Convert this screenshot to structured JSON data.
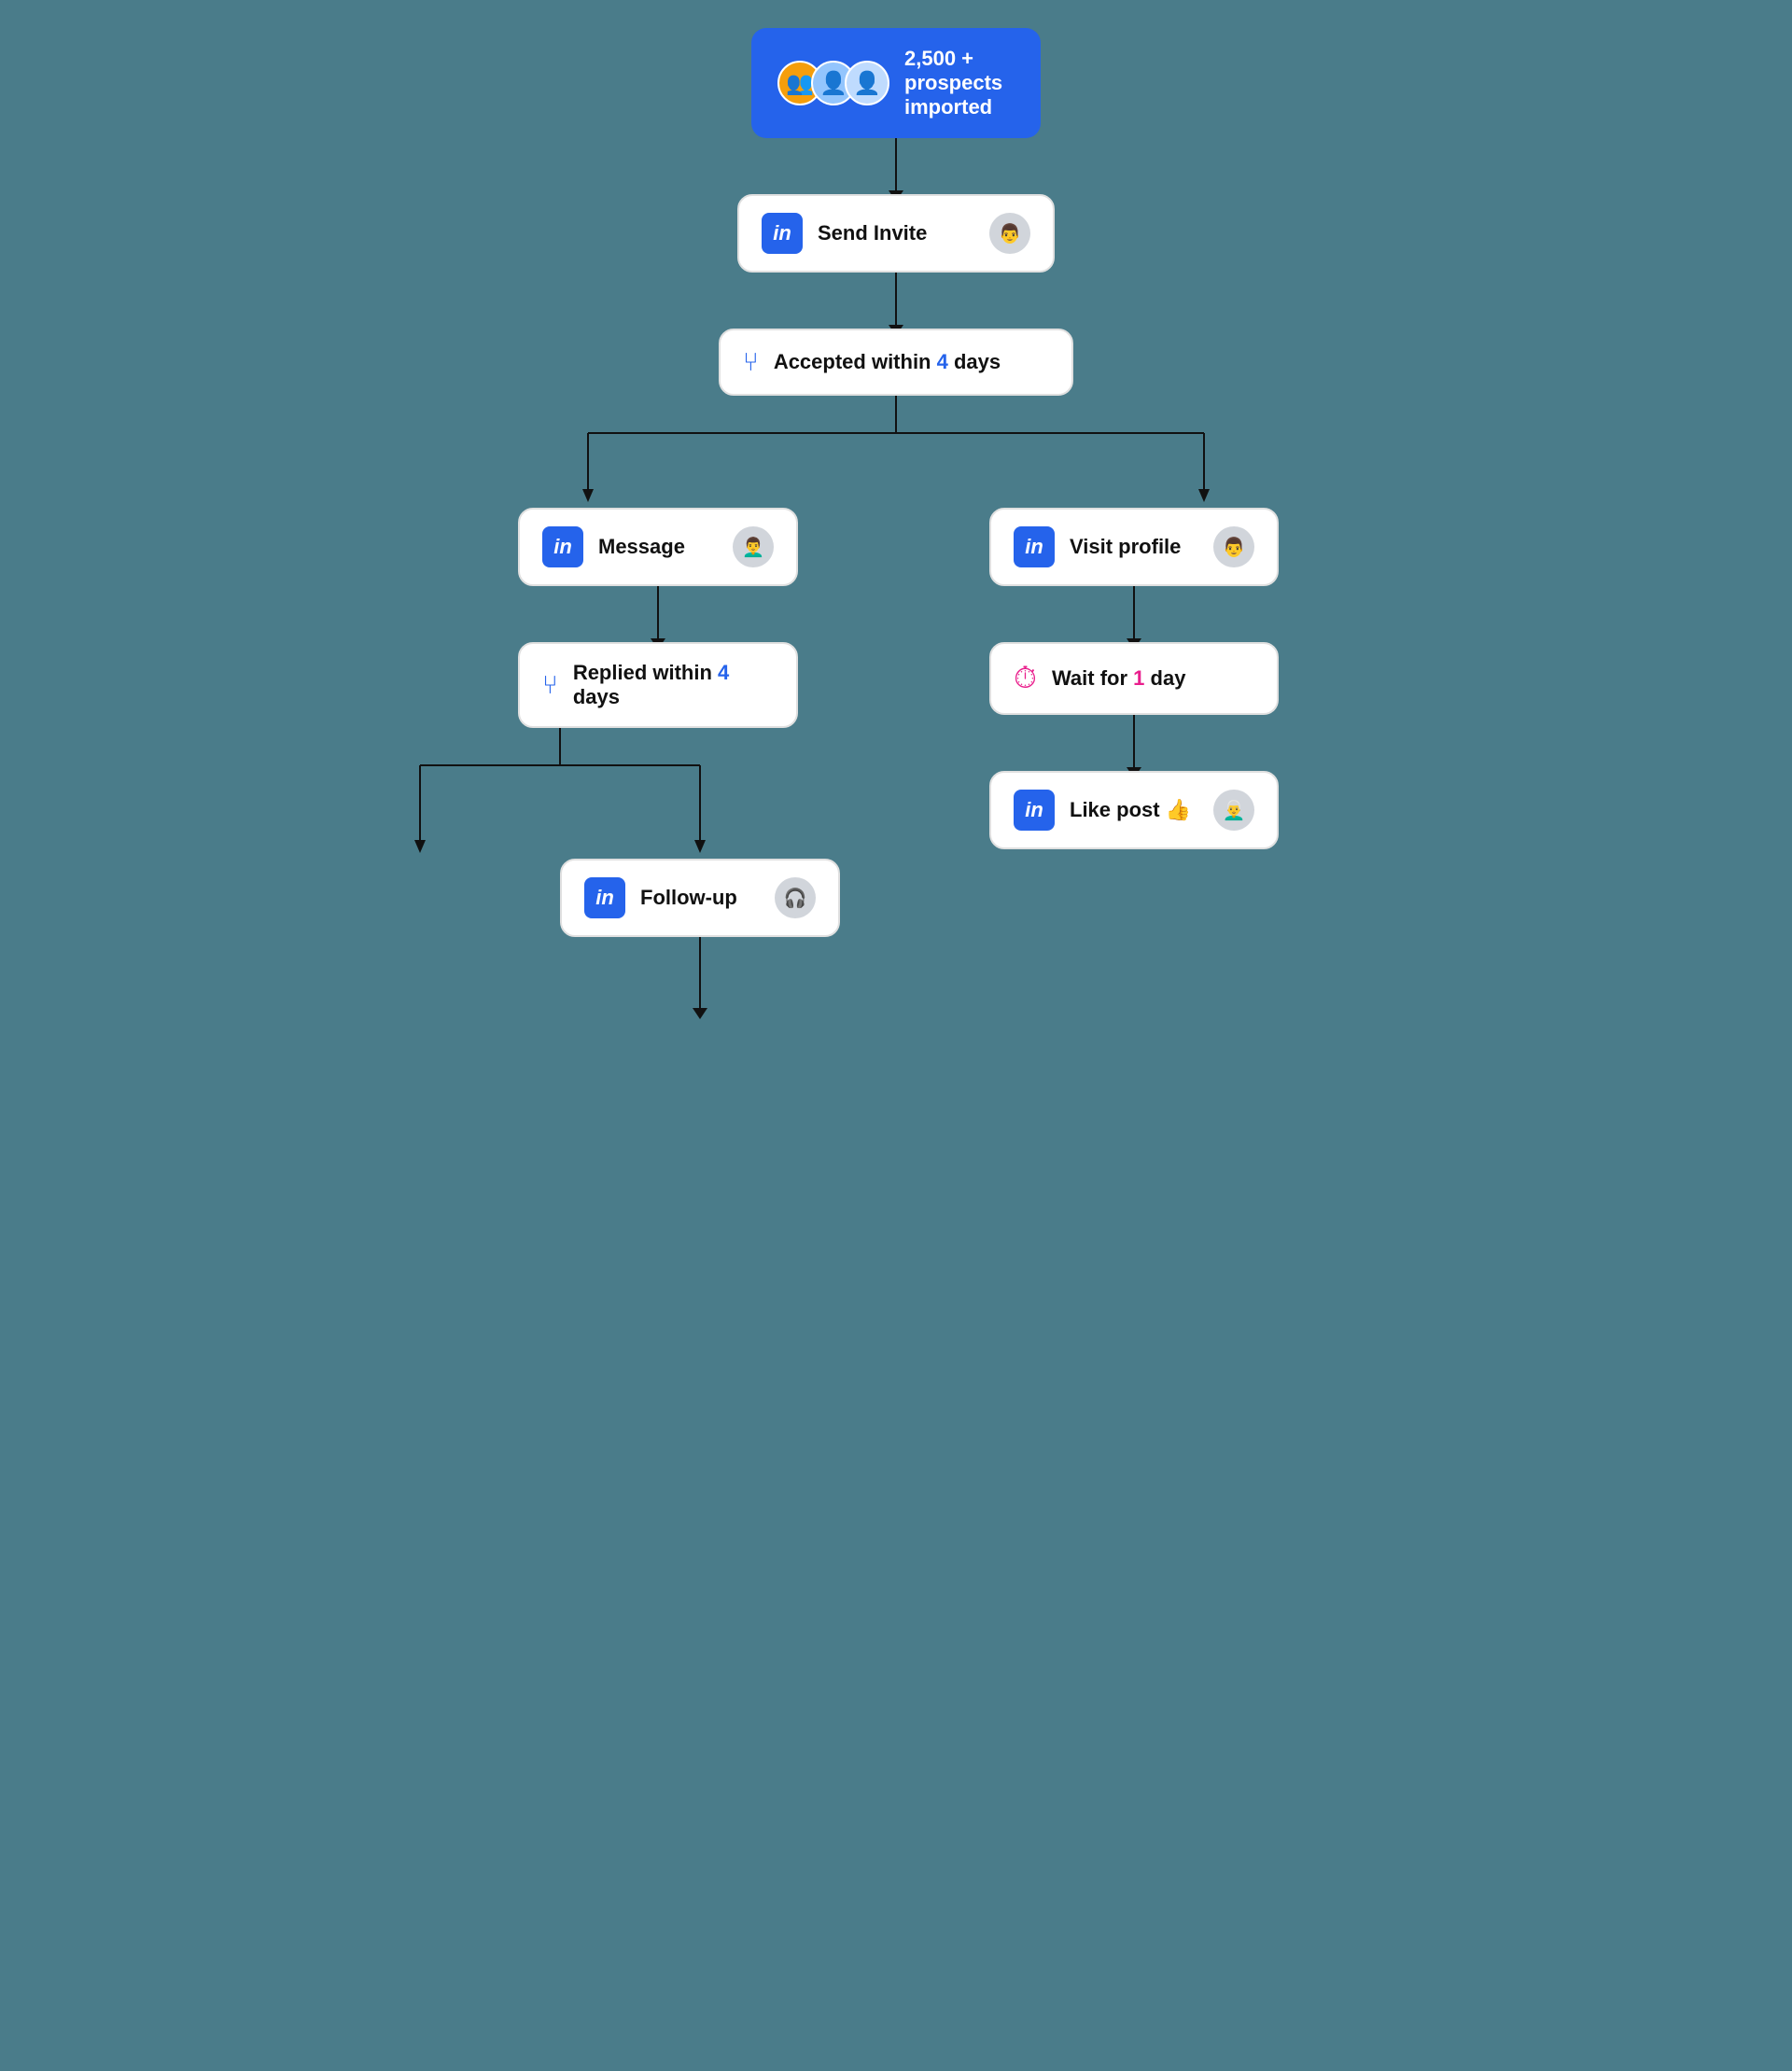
{
  "top_node": {
    "label": "2,500 + prospects imported",
    "avatar_emojis": [
      "👥",
      "👤",
      "👤"
    ]
  },
  "send_invite": {
    "label": "Send Invite",
    "avatar_emoji": "👨"
  },
  "accepted": {
    "icon": "fork",
    "label_before": "Accepted within ",
    "highlight": "4",
    "label_after": " days"
  },
  "message": {
    "label": "Message",
    "avatar_emoji": "👨‍🦱"
  },
  "visit_profile": {
    "label": "Visit profile",
    "avatar_emoji": "👨"
  },
  "replied": {
    "icon": "fork",
    "label_before": "Replied within ",
    "highlight": "4",
    "label_after": " days"
  },
  "wait_for_day": {
    "icon": "timer",
    "label_before": "Wait for ",
    "highlight": "1",
    "label_after": " day"
  },
  "followup": {
    "label": "Follow-up",
    "avatar_emoji": "🎧"
  },
  "like_post": {
    "label": "Like post 👍",
    "avatar_emoji": "👨‍🦳"
  },
  "colors": {
    "blue": "#2563eb",
    "pink": "#e91e8c",
    "bg": "#4a7c8a",
    "border": "#e0e0e0",
    "text": "#111111"
  }
}
